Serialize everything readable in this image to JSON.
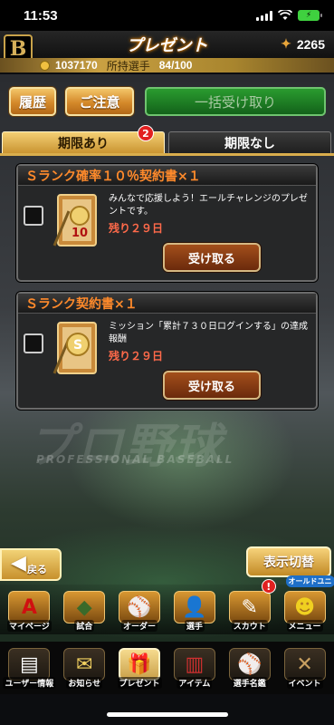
{
  "status_bar": {
    "time": "11:53",
    "battery": "⚡"
  },
  "header": {
    "logo": "B",
    "title": "プレゼント",
    "points": "2265",
    "coins": "1037170",
    "owned_label": "所持選手",
    "owned_count": "84/100"
  },
  "actions": {
    "history": "履歴",
    "notice": "ご注意",
    "receive_all": "一括受け取り"
  },
  "tabs": {
    "with_deadline": "期限あり",
    "with_deadline_badge": "2",
    "no_deadline": "期限なし"
  },
  "background": {
    "brand": "プロ野球",
    "sub": "PROFESSIONAL BASEBALL"
  },
  "presents": [
    {
      "title": "Ｓランク確率１０％契約書×１",
      "icon_label": "10",
      "description": "みんなで応援しよう！エールチャレンジのプレゼントです。",
      "remaining": "残り２９日",
      "receive": "受け取る"
    },
    {
      "title": "Ｓランク契約書×１",
      "icon_label": "S",
      "description": "ミッション「累計７３０日ログインする」の達成報酬",
      "remaining": "残り２９日",
      "receive": "受け取る"
    }
  ],
  "controls": {
    "back": "戻る",
    "switch": "表示切替"
  },
  "nav_main": [
    {
      "label": "マイページ",
      "icon": "A",
      "alert": ""
    },
    {
      "label": "試合",
      "icon": "◆",
      "alert": ""
    },
    {
      "label": "オーダー",
      "icon": "⚾",
      "alert": ""
    },
    {
      "label": "選手",
      "icon": "👤",
      "alert": ""
    },
    {
      "label": "スカウト",
      "icon": "✎",
      "alert": "!"
    },
    {
      "label": "メニュー",
      "icon": "☻",
      "alert": "",
      "tag": "オールドユニ"
    }
  ],
  "nav_sub": [
    {
      "label": "ユーザー情報",
      "icon": "▤"
    },
    {
      "label": "お知らせ",
      "icon": "✉"
    },
    {
      "label": "プレゼント",
      "icon": "🎁"
    },
    {
      "label": "アイテム",
      "icon": "▥"
    },
    {
      "label": "選手名鑑",
      "icon": "⚾"
    },
    {
      "label": "イベント",
      "icon": "✕"
    }
  ],
  "colors": {
    "accent_gold": "#c99431",
    "title_orange": "#ff8a2b",
    "remaining_red": "#ff6a4a",
    "green_button": "#1f7a24"
  }
}
